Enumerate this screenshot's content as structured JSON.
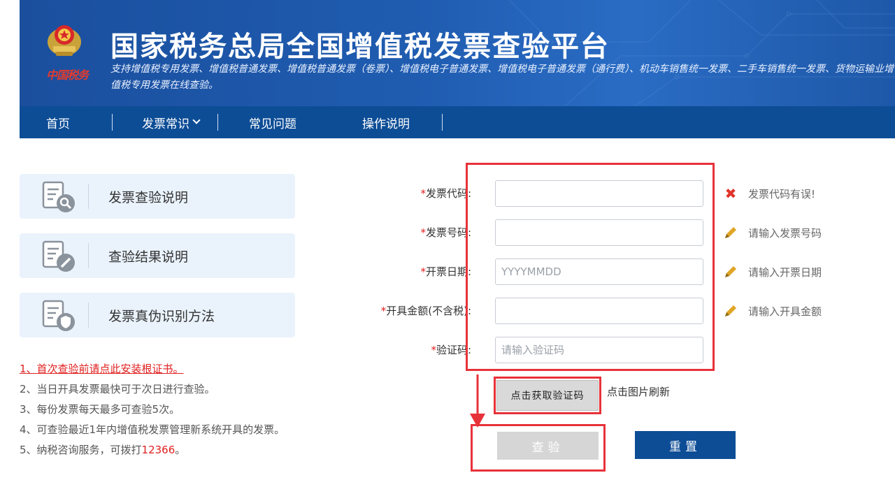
{
  "header": {
    "brand_mark": "中国税务",
    "title": "国家税务总局全国增值税发票查验平台",
    "subtitle": "支持增值税专用发票、增值税普通发票、增值税普通发票（卷票）、增值税电子普通发票、增值税电子普通发票（通行费）、机动车销售统一发票、二手车销售统一发票、货物运输业增值税专用发票在线查验。"
  },
  "nav": {
    "home": "首页",
    "knowledge": "发票常识",
    "faq": "常见问题",
    "guide": "操作说明"
  },
  "sidebar": {
    "items": [
      {
        "label": "发票查验说明",
        "icon": "document-search-icon"
      },
      {
        "label": "查验结果说明",
        "icon": "document-edit-icon"
      },
      {
        "label": "发票真伪识别方法",
        "icon": "document-shield-icon"
      }
    ]
  },
  "notes": {
    "n1": "1、首次查验前请点此安装根证书。",
    "n2": "2、当日开具发票最快可于次日进行查验。",
    "n3": "3、每份发票每天最多可查验5次。",
    "n4": "4、可查验最近1年内增值税发票管理新系统开具的发票。",
    "n5_prefix": "5、纳税咨询服务，可拨打",
    "n5_phone": "12366",
    "n5_suffix": "。"
  },
  "form": {
    "invoice_code": {
      "label": "发票代码:",
      "value": "",
      "placeholder": "",
      "hint": "发票代码有误!",
      "hint_icon": "error-x-icon"
    },
    "invoice_number": {
      "label": "发票号码:",
      "value": "",
      "placeholder": "",
      "hint": "请输入发票号码",
      "hint_icon": "pencil-icon"
    },
    "issue_date": {
      "label": "开票日期:",
      "value": "",
      "placeholder": "YYYYMMDD",
      "hint": "请输入开票日期",
      "hint_icon": "pencil-icon"
    },
    "amount": {
      "label": "开具金额(不含税):",
      "value": "",
      "placeholder": "",
      "hint": "请输入开具金额",
      "hint_icon": "pencil-icon"
    },
    "captcha": {
      "label": "验证码:",
      "value": "",
      "placeholder": "请输入验证码"
    },
    "captcha_image_text": "点击获取验证码",
    "captcha_refresh": "点击图片刷新",
    "required_mark": "*"
  },
  "buttons": {
    "check": "查验",
    "reset": "重置"
  },
  "colors": {
    "banner_blue": "#1f5cb0",
    "nav_blue": "#0d4d96",
    "annotation_red": "#e8323a",
    "error_red": "#e02020",
    "pencil_yellow": "#e0a526"
  }
}
